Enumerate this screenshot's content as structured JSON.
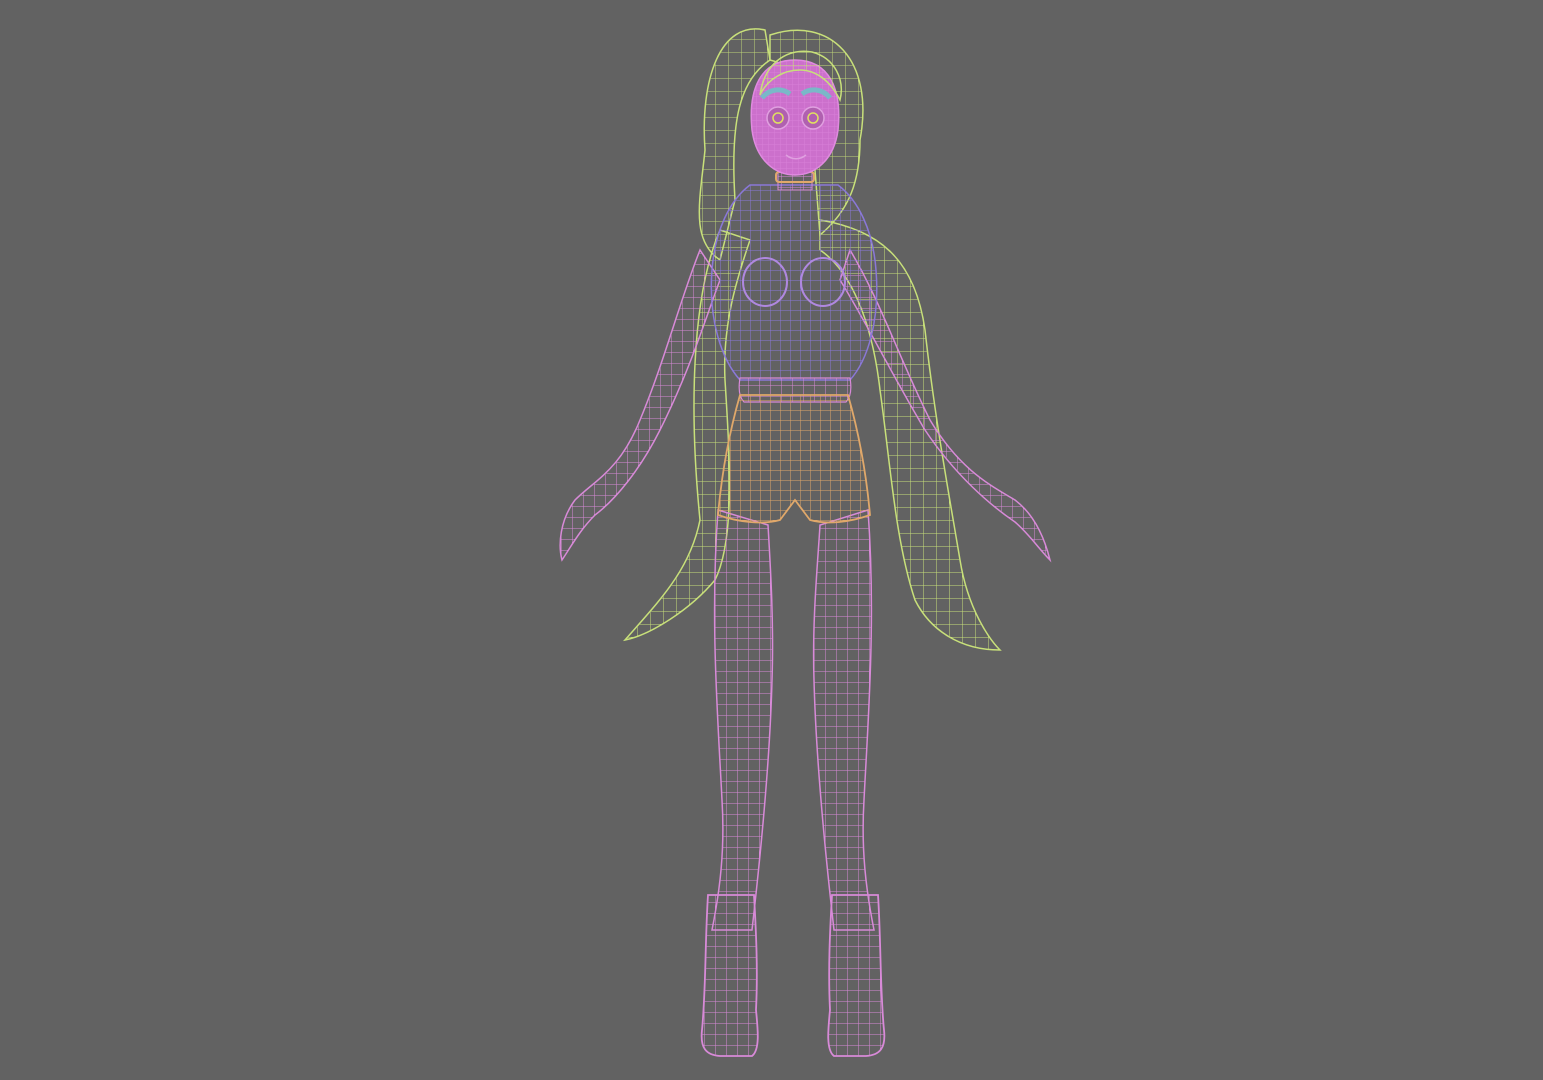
{
  "viewport": {
    "background": "#626262",
    "render_mode": "wireframe",
    "subject": "character-a-pose"
  },
  "mesh_colors": {
    "body": "#d88ad8",
    "hair": "#c8e07a",
    "top": "#8a78d8",
    "shorts": "#e0a86a",
    "eyebrows": "#7ab8c8",
    "choker": "#e0a86a"
  }
}
